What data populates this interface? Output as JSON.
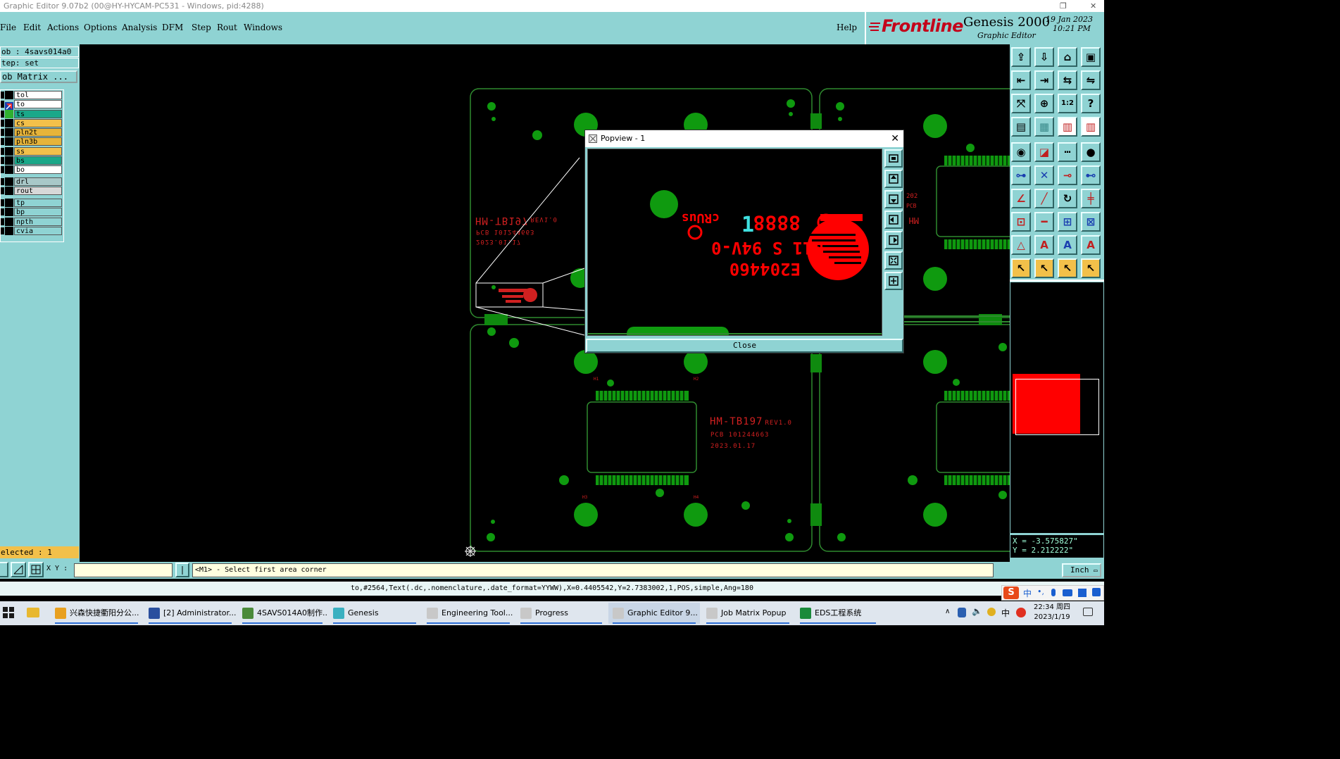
{
  "window": {
    "title": "Graphic Editor 9.07b2 (00@HY-HYCAM-PC531 - Windows, pid:4288)"
  },
  "menu": {
    "items": [
      "File",
      "Edit",
      "Actions",
      "Options",
      "Analysis",
      "DFM",
      "Step",
      "Rout",
      "Windows"
    ],
    "help": "Help"
  },
  "brand": {
    "logo": "Frontline",
    "product": "Genesis 2000",
    "subtitle": "Graphic Editor",
    "date": "19 Jan 2023",
    "time": "10:21 PM"
  },
  "job_panel": {
    "job": "ob : 4savs014a0",
    "step": "tep: set",
    "job_matrix": "ob Matrix ...",
    "layers": [
      {
        "name": "tol",
        "color": "#ffffff"
      },
      {
        "name": "to",
        "color": "#ffffff"
      },
      {
        "name": "ts",
        "color": "#1aa889"
      },
      {
        "name": "cs",
        "color": "#f2c04a"
      },
      {
        "name": "pln2t",
        "color": "#e6b43a"
      },
      {
        "name": "pln3b",
        "color": "#e6b43a"
      },
      {
        "name": "ss",
        "color": "#f2c04a"
      },
      {
        "name": "bs",
        "color": "#1aa889"
      },
      {
        "name": "bo",
        "color": "#ffffff"
      },
      {
        "name": "drl",
        "color": "#a8c8c8"
      },
      {
        "name": "rout",
        "color": "#d8d8d8"
      },
      {
        "name": "tp",
        "color": "#8fd3d3"
      },
      {
        "name": "bp",
        "color": "#8fd3d3"
      },
      {
        "name": "npth",
        "color": "#8fd3d3"
      },
      {
        "name": "cvia",
        "color": "#8fd3d3"
      }
    ],
    "selected": "elected : 1"
  },
  "canvas": {
    "board_text_line1": "HM-TB197",
    "board_text_rev": "REV1.0",
    "board_text_line2": "PCB 101244663",
    "board_text_line3": "2023.01.17",
    "pad_labels": [
      "H1",
      "H2",
      "H3",
      "H4"
    ]
  },
  "popup": {
    "title": "Popview - 1",
    "close_label": "Close",
    "marking_code": "E204460",
    "marking_rating": "M11 S 94V-0",
    "marking_digits": "8888",
    "marking_week": "1",
    "marking_cert": "cRUus"
  },
  "command": {
    "xy_label": "X Y :",
    "xy_value": "",
    "prompt": "<M1> - Select first area corner"
  },
  "status_line": "to,#2564,Text(.dc,.nomenclature,.date_format=YYWW),X=0.4405542,Y=2.7383002,1,POS,simple,Ang=180",
  "units": "Inch",
  "coords": {
    "x": "X = -3.575827\"",
    "y": "Y =  2.212222\""
  },
  "taskbar": {
    "items": [
      {
        "label": "兴森快捷衢阳分公...",
        "icon": "#e8a020"
      },
      {
        "label": "[2] Administrator...",
        "icon": "#2a4f9e"
      },
      {
        "label": "4SAVS014A0制作...",
        "icon": "#4a8a3a"
      },
      {
        "label": "Genesis",
        "icon": "#3ab0c0"
      },
      {
        "label": "Engineering Tool...",
        "icon": "#c8c8c8"
      },
      {
        "label": "Progress",
        "icon": "#c8c8c8"
      },
      {
        "label": "Graphic Editor 9...",
        "icon": "#c8c8c8"
      },
      {
        "label": "Job Matrix Popup",
        "icon": "#c8c8c8"
      },
      {
        "label": "EDS工程系统",
        "icon": "#1a8a3a"
      }
    ],
    "tray_ime": "中",
    "clock_time": "22:34 周四",
    "clock_date": "2023/1/19"
  }
}
